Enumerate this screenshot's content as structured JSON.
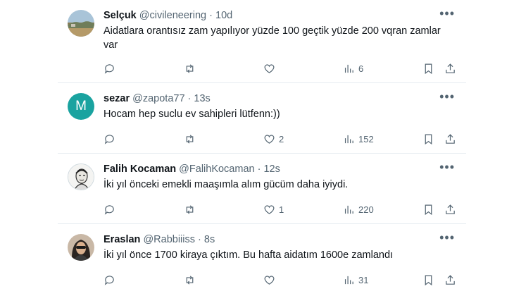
{
  "tweets": [
    {
      "name": "Selçuk",
      "handle": "@civileneering",
      "time": "10d",
      "text": "Aidatlara orantısız zam yapılıyor yüzde 100 geçtik yüzde 200 vqran zamlar var",
      "replies": "",
      "retweets": "",
      "likes": "",
      "views": "6",
      "avatar": "landscape-photo"
    },
    {
      "name": "sezar",
      "handle": "@zapota77",
      "time": "13s",
      "text": "Hocam hep suclu ev sahipleri lütfenn:))",
      "replies": "",
      "retweets": "",
      "likes": "2",
      "views": "152",
      "avatar_letter": "M",
      "avatar_color": "#1aa3a0"
    },
    {
      "name": "Falih Kocaman",
      "handle": "@FalihKocaman",
      "time": "12s",
      "text": "İki yıl önceki emekli maaşımla alım gücüm daha iyiydi.",
      "replies": "",
      "retweets": "",
      "likes": "1",
      "views": "220",
      "avatar": "sketch-portrait"
    },
    {
      "name": "Eraslan",
      "handle": "@Rabbiiiss",
      "time": "8s",
      "text": "İki yıl önce 1700 kiraya çıktım. Bu hafta aidatım 1600e zamlandı",
      "replies": "",
      "retweets": "",
      "likes": "",
      "views": "31",
      "avatar": "portrait-photo"
    }
  ],
  "separator": "·",
  "more_glyph": "•••"
}
